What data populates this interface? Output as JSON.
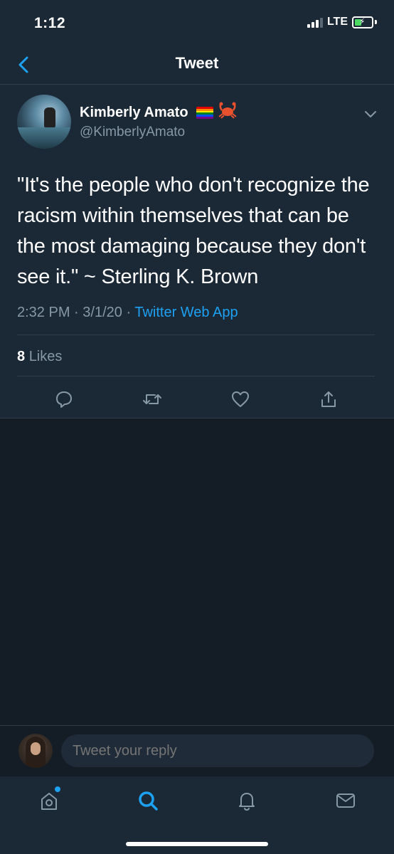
{
  "status_bar": {
    "time": "1:12",
    "network": "LTE"
  },
  "nav": {
    "title": "Tweet",
    "back_icon": "chevron-left-icon"
  },
  "tweet": {
    "author_name": "Kimberly Amato",
    "author_emojis": [
      "rainbow-flag-icon",
      "crab-icon"
    ],
    "author_handle": "@KimberlyAmato",
    "text": "\"It's the people who don't recognize the racism within themselves that can be the most damaging because they don't see it.\" ~ Sterling K. Brown",
    "time": "2:32 PM",
    "date": "3/1/20",
    "separator": "·",
    "source": "Twitter Web App",
    "likes_count": "8",
    "likes_label": "Likes",
    "actions": [
      "reply-icon",
      "retweet-icon",
      "like-icon",
      "share-icon"
    ]
  },
  "reply": {
    "placeholder": "Tweet your reply"
  },
  "tab_bar": {
    "items": [
      "home-icon",
      "search-icon",
      "notifications-icon",
      "messages-icon"
    ],
    "active": "search-icon"
  },
  "colors": {
    "background": "#141d26",
    "surface": "#1b2836",
    "accent": "#1da1f2",
    "secondary_text": "#8899a6",
    "divider": "#2f3d4a"
  }
}
